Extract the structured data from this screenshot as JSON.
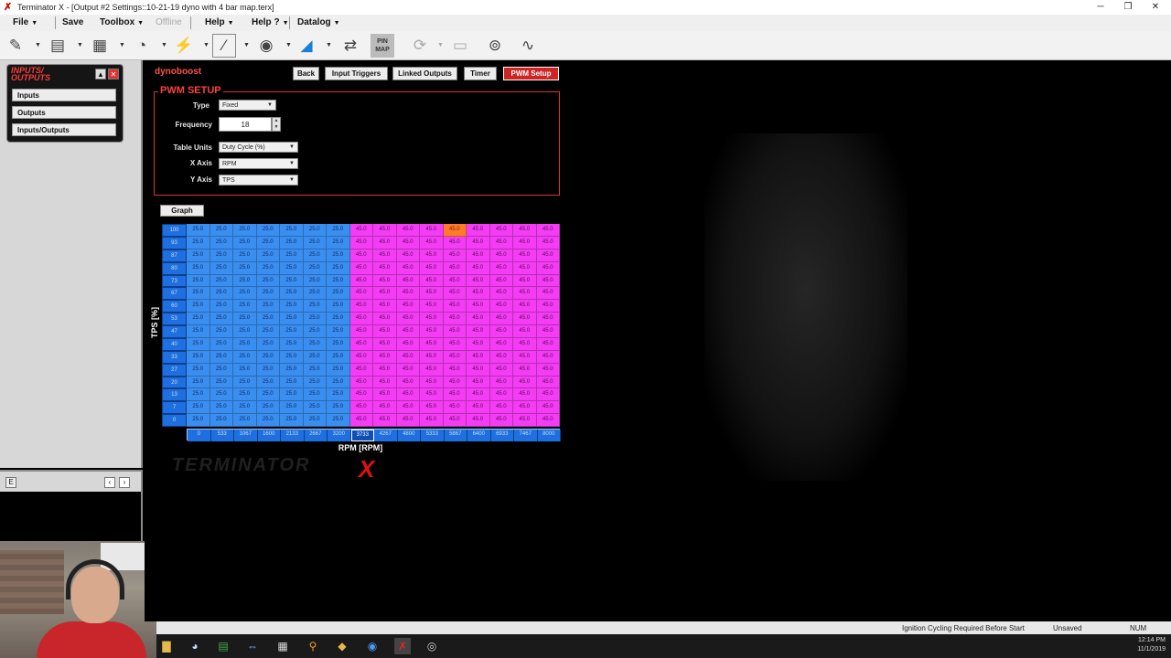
{
  "window": {
    "title": "Terminator X - [Output #2 Settings::10-21-19 dyno with 4 bar map.terx]",
    "app_icon": "terminator-x-icon"
  },
  "menubar": {
    "file": "File",
    "save": "Save",
    "toolbox": "Toolbox",
    "offline": "Offline",
    "help": "Help",
    "help2": "Help ?",
    "datalog": "Datalog"
  },
  "toolbar": {
    "sensors_label": "SENSORS",
    "pinmap_label": "PIN MAP"
  },
  "left_panel": {
    "title_line1": "INPUTS/",
    "title_line2": "OUTPUTS",
    "buttons": [
      "Inputs",
      "Outputs",
      "Inputs/Outputs"
    ],
    "lower_label": "E"
  },
  "main": {
    "profile_name": "dynoboost",
    "tabs": [
      "Back",
      "Input Triggers",
      "Linked Outputs",
      "Timer",
      "PWM Setup"
    ],
    "active_tab": "PWM Setup",
    "pwm_setup": {
      "section_title": "PWM SETUP",
      "type_label": "Type",
      "type_value": "Fixed",
      "frequency_label": "Frequency",
      "frequency_value": "18",
      "table_units_label": "Table Units",
      "table_units_value": "Duty Cycle (%)",
      "x_axis_label": "X Axis",
      "x_axis_value": "RPM",
      "y_axis_label": "Y Axis",
      "y_axis_value": "TPS"
    },
    "graph_button": "Graph",
    "table": {
      "y_axis_title": "TPS [%]",
      "x_axis_title": "RPM [RPM]",
      "y_breakpoints": [
        "100",
        "93",
        "87",
        "80",
        "73",
        "67",
        "60",
        "53",
        "47",
        "40",
        "33",
        "27",
        "20",
        "13",
        "7",
        "0"
      ],
      "x_breakpoints": [
        "0",
        "533",
        "1067",
        "1600",
        "2133",
        "2667",
        "3200",
        "3733",
        "4267",
        "4800",
        "5333",
        "5867",
        "6400",
        "6933",
        "7467",
        "8000"
      ],
      "low_value": "25.0",
      "high_value": "45.0",
      "low_columns": 7,
      "highlight_color_low": "#3a8ef0",
      "highlight_color_high": "#f33cf3",
      "current_x_index": 7,
      "selected_cell": [
        0,
        11
      ]
    }
  },
  "statusbar": {
    "message": "Ignition Cycling Required Before Start",
    "save_state": "Unsaved",
    "num_lock": "NUM"
  },
  "taskbar": {
    "time": "12:14 PM",
    "date": "11/1/2019"
  }
}
